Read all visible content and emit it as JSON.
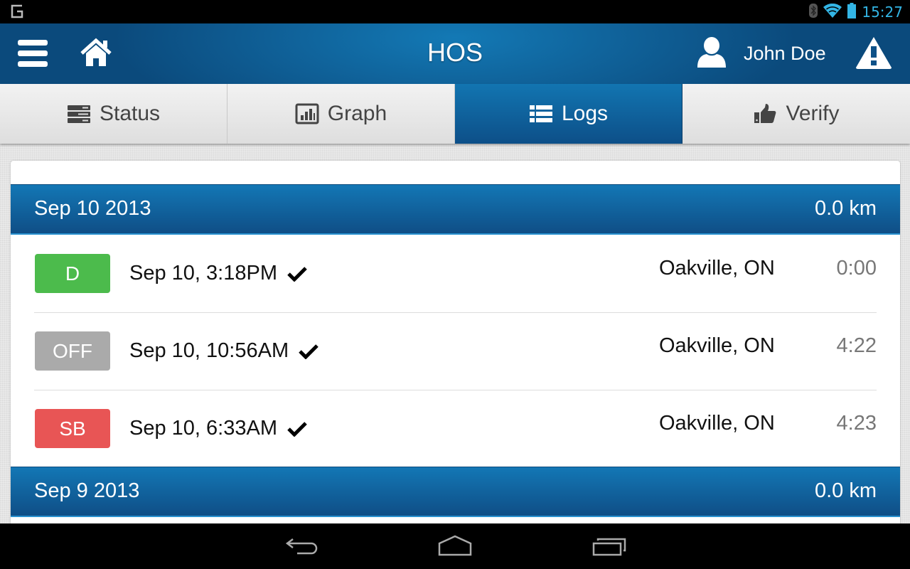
{
  "status_bar": {
    "left_icon": "g-notification-icon",
    "time": "15:27",
    "icons": [
      "bluetooth-icon",
      "wifi-icon",
      "battery-icon"
    ],
    "accent_color": "#33b5e5"
  },
  "action_bar": {
    "title": "HOS",
    "user_name": "John Doe",
    "icons": [
      "menu-icon",
      "home-icon",
      "user-icon",
      "warning-icon"
    ]
  },
  "tabs": [
    {
      "label": "Status",
      "icon": "server-icon",
      "active": false
    },
    {
      "label": "Graph",
      "icon": "bar-chart-icon",
      "active": false
    },
    {
      "label": "Logs",
      "icon": "list-icon",
      "active": true
    },
    {
      "label": "Verify",
      "icon": "thumbs-up-icon",
      "active": false
    }
  ],
  "logs": {
    "days": [
      {
        "date": "Sep 10 2013",
        "distance": "0.0 km",
        "entries": [
          {
            "status": "D",
            "status_color": "#4cbb4c",
            "time": "Sep 10, 3:18PM",
            "verified": true,
            "location": "Oakville, ON",
            "duration": "0:00"
          },
          {
            "status": "OFF",
            "status_color": "#aaaaaa",
            "time": "Sep 10, 10:56AM",
            "verified": true,
            "location": "Oakville, ON",
            "duration": "4:22"
          },
          {
            "status": "SB",
            "status_color": "#e85555",
            "time": "Sep 10, 6:33AM",
            "verified": true,
            "location": "Oakville, ON",
            "duration": "4:23"
          }
        ]
      },
      {
        "date": "Sep 9 2013",
        "distance": "0.0 km",
        "entries": []
      }
    ]
  },
  "nav_bar": {
    "buttons": [
      "back-icon",
      "home-nav-icon",
      "recents-icon"
    ]
  },
  "colors": {
    "primary_blue": "#0f5f96",
    "header_blue_light": "#1377b5",
    "header_blue_dark": "#0f4e86"
  }
}
